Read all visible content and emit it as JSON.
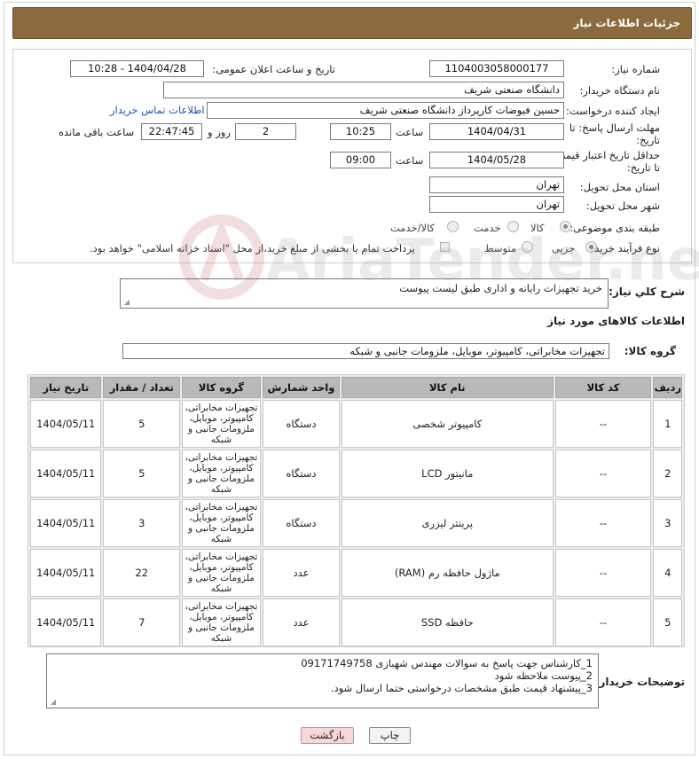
{
  "header": {
    "title": "جزئیات اطلاعات نیاز"
  },
  "form": {
    "need_number": {
      "label": "شماره نیاز:",
      "value": "1104003058000177"
    },
    "announce_datetime": {
      "label": "تاریخ و ساعت اعلان عمومی:",
      "value": "1404/04/28 - 10:28"
    },
    "buyer_org": {
      "label": "نام دستگاه خریدار:",
      "value": "دانشگاه صنعتی شریف"
    },
    "requester": {
      "label": "ایجاد کننده درخواست:",
      "value": "حسین فیوضات کارپرداز دانشگاه صنعتی شریف",
      "contact_link": "اطلاعات تماس خریدار"
    },
    "response_deadline": {
      "label_line1": "مهلت ارسال پاسخ: تا",
      "label_line2": "تاریخ:",
      "date": "1404/04/31",
      "time_label": "ساعت",
      "time": "10:25",
      "days": "2",
      "days_label": "روز و",
      "remaining": "22:47:45",
      "remaining_label": "ساعت باقی مانده"
    },
    "price_validity": {
      "label_line1": "حداقل تاریخ اعتبار قیمت:",
      "label_line2": "تا تاریخ:",
      "date": "1404/05/28",
      "time_label": "ساعت",
      "time": "09:00"
    },
    "delivery_province": {
      "label": "استان محل تحویل:",
      "value": "تهران"
    },
    "delivery_city": {
      "label": "شهر محل تحویل:",
      "value": "تهران"
    },
    "category": {
      "label": "طبقه بندی موضوعی:",
      "options": [
        "کالا",
        "خدمت",
        "کالا/خدمت"
      ],
      "selected": "کالا"
    },
    "purchase_type": {
      "label": "نوع فرآیند خرید :",
      "options": [
        "جزیی",
        "متوسط"
      ],
      "selected": "جزیی",
      "payment_note": "پرداخت تمام یا بخشی از مبلغ خرید،از محل \"اسناد خزانه اسلامی\" خواهد بود."
    }
  },
  "description": {
    "label": "شرح کلي نياز:",
    "value": "خرید تجهیزات رایانه و اداری طبق لیست پیوست"
  },
  "goods_info": {
    "title": "اطلاعات کالاهای مورد نیاز",
    "group_label": "گروه کالا:",
    "group_value": "تجهیزات مخابراتی، کامپیوتر، موبایل، ملزومات جانبی و شبکه"
  },
  "table": {
    "headers": [
      "ردیف",
      "کد کالا",
      "نام کالا",
      "واحد شمارش",
      "گروه کالا",
      "تعداد / مقدار",
      "تاریخ نیاز"
    ],
    "rows": [
      {
        "row": "1",
        "code": "--",
        "name": "کامپیوتر شخصی",
        "unit": "دستگاه",
        "group": "تجهیزات مخابراتی، کامپیوتر، موبایل، ملزومات جانبی و شبکه",
        "qty": "5",
        "date": "1404/05/11"
      },
      {
        "row": "2",
        "code": "--",
        "name": "مانیتور LCD",
        "unit": "دستگاه",
        "group": "تجهیزات مخابراتی، کامپیوتر، موبایل، ملزومات جانبی و شبکه",
        "qty": "5",
        "date": "1404/05/11"
      },
      {
        "row": "3",
        "code": "--",
        "name": "پرینتر لیزری",
        "unit": "دستگاه",
        "group": "تجهیزات مخابراتی، کامپیوتر، موبایل، ملزومات جانبی و شبکه",
        "qty": "3",
        "date": "1404/05/11"
      },
      {
        "row": "4",
        "code": "--",
        "name": "ماژول حافظه رم (RAM)",
        "unit": "عدد",
        "group": "تجهیزات مخابراتی، کامپیوتر، موبایل، ملزومات جانبی و شبکه",
        "qty": "22",
        "date": "1404/05/11"
      },
      {
        "row": "5",
        "code": "--",
        "name": "حافظه SSD",
        "unit": "عدد",
        "group": "تجهیزات مخابراتی، کامپیوتر، موبایل، ملزومات جانبی و شبکه",
        "qty": "7",
        "date": "1404/05/11"
      }
    ]
  },
  "buyer_notes": {
    "label": "توضیحات خریدار:",
    "lines": [
      "1_کارشناس جهت پاسخ به سوالات مهندس شهبازی 09171749758",
      "2_پیوست ملاحظه شود",
      "3_پیشنهاد قیمت طبق مشخصات درخواستی حتما ارسال شود."
    ]
  },
  "buttons": {
    "print": "چاپ",
    "back": "بازگشت"
  },
  "watermark": {
    "text": "AriaTender.neT"
  },
  "colors": {
    "title_bg": "#8b6b3e",
    "link": "#1a55b0",
    "back_button": "#f8d6d9",
    "table_header": "#b9b9b9"
  }
}
